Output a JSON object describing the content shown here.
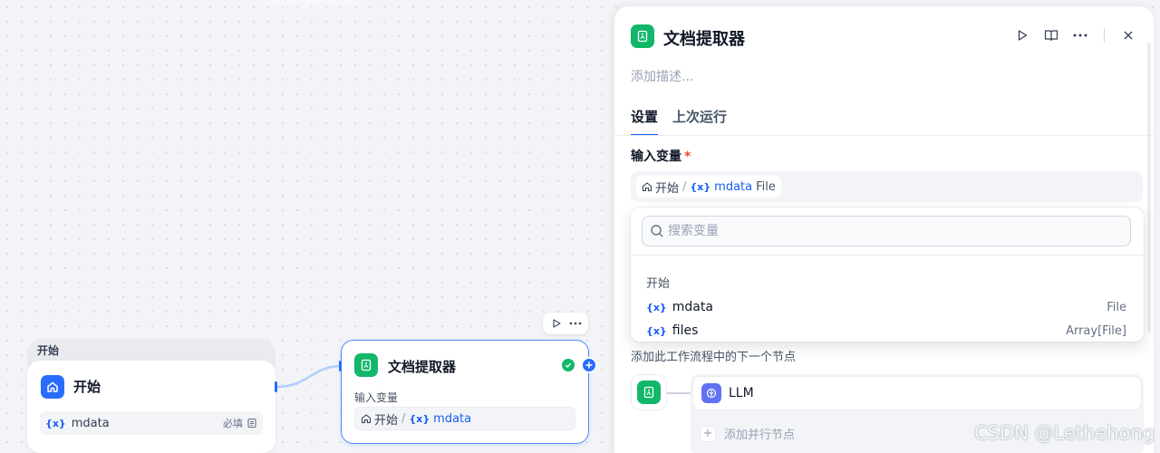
{
  "canvas": {
    "start_group_label": "开始",
    "start_node": {
      "title": "开始",
      "var_glyph": "{x}",
      "var_name": "mdata",
      "required": "必填"
    },
    "doc_node": {
      "title": "文档提取器",
      "input_label": "输入变量",
      "ref_node": "开始",
      "ref_sep": "/",
      "ref_glyph": "{x}",
      "ref_var": "mdata"
    }
  },
  "panel": {
    "title": "文档提取器",
    "description_placeholder": "添加描述...",
    "tabs": [
      {
        "label": "设置",
        "active": true
      },
      {
        "label": "上次运行",
        "active": false
      }
    ],
    "input_field_label": "输入变量",
    "required_mark": "*",
    "selected_variable": {
      "node": "开始",
      "sep": "/",
      "glyph": "{x}",
      "name": "mdata",
      "type": "File"
    },
    "dropdown": {
      "search_placeholder": "搜索变量",
      "group": "开始",
      "items": [
        {
          "glyph": "{x}",
          "name": "mdata",
          "type": "File"
        },
        {
          "glyph": "{x}",
          "name": "files",
          "type": "Array[File]"
        }
      ]
    },
    "next_step_desc": "添加此工作流程中的下一个节点",
    "next_node": "LLM",
    "add_parallel": "添加并行节点"
  },
  "colors": {
    "accent": "#296dff",
    "doc_icon": "#12b76a",
    "llm_icon": "#6172f3",
    "success": "#12b76a",
    "required": "#f04438"
  },
  "watermark": "CSDN @Lethehong"
}
